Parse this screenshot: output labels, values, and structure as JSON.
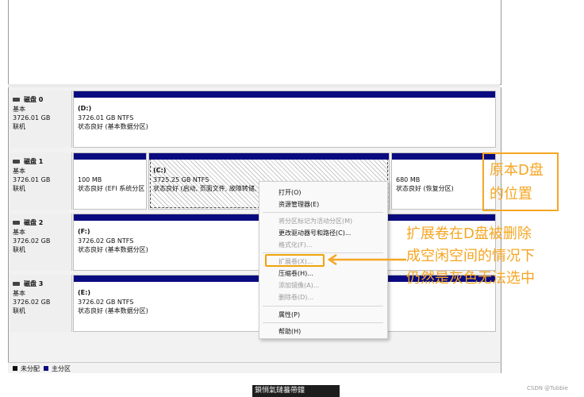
{
  "disks": [
    {
      "name": "磁盘 0",
      "type": "基本",
      "size": "3726.01 GB",
      "status": "联机",
      "partitions": [
        {
          "label": "(D:)",
          "detail": "3726.01 GB NTFS",
          "status": "状态良好 (基本数据分区)"
        }
      ]
    },
    {
      "name": "磁盘 1",
      "type": "基本",
      "size": "3726.01 GB",
      "status": "联机",
      "partitions": [
        {
          "label": "",
          "detail": "100 MB",
          "status": "状态良好 (EFI 系统分区)"
        },
        {
          "label": "(C:)",
          "detail": "3725.25 GB NTFS",
          "status": "状态良好 (启动, 页面文件, 故障转储,"
        },
        {
          "label": "",
          "detail": "680 MB",
          "status": "状态良好 (恢复分区)"
        }
      ]
    },
    {
      "name": "磁盘 2",
      "type": "基本",
      "size": "3726.02 GB",
      "status": "联机",
      "partitions": [
        {
          "label": "(F:)",
          "detail": "3726.02 GB NTFS",
          "status": "状态良好 (基本数据分区)"
        }
      ]
    },
    {
      "name": "磁盘 3",
      "type": "基本",
      "size": "3726.02 GB",
      "status": "联机",
      "partitions": [
        {
          "label": "(E:)",
          "detail": "3726.02 GB NTFS",
          "status": "状态良好 (基本数据分区)"
        }
      ]
    }
  ],
  "context_menu": {
    "open": "打开(O)",
    "explorer": "资源管理器(E)",
    "mark_active": "将分区标记为活动分区(M)",
    "change_letter": "更改驱动器号和路径(C)...",
    "format": "格式化(F)...",
    "extend": "扩展卷(X)...",
    "shrink": "压缩卷(H)...",
    "add_mirror": "添加镜像(A)...",
    "delete": "删除卷(D)...",
    "properties": "属性(P)",
    "help": "帮助(H)"
  },
  "legend": {
    "unallocated": "未分配",
    "primary": "主分区",
    "unallocated_color": "#111111",
    "primary_color": "#0a0a80"
  },
  "annotations": {
    "box_line1": "原本D盘",
    "box_line2": "的位置",
    "note_line1": "扩展卷在D盘被删除",
    "note_line2": "成空闲空间的情况下",
    "note_line3": "仍然是灰色无法选中",
    "accent_color": "#f5a623"
  },
  "taskbar_text": "鎖悄氣鏈蟇帶鐘",
  "watermark": "CSDN @Tubbie"
}
